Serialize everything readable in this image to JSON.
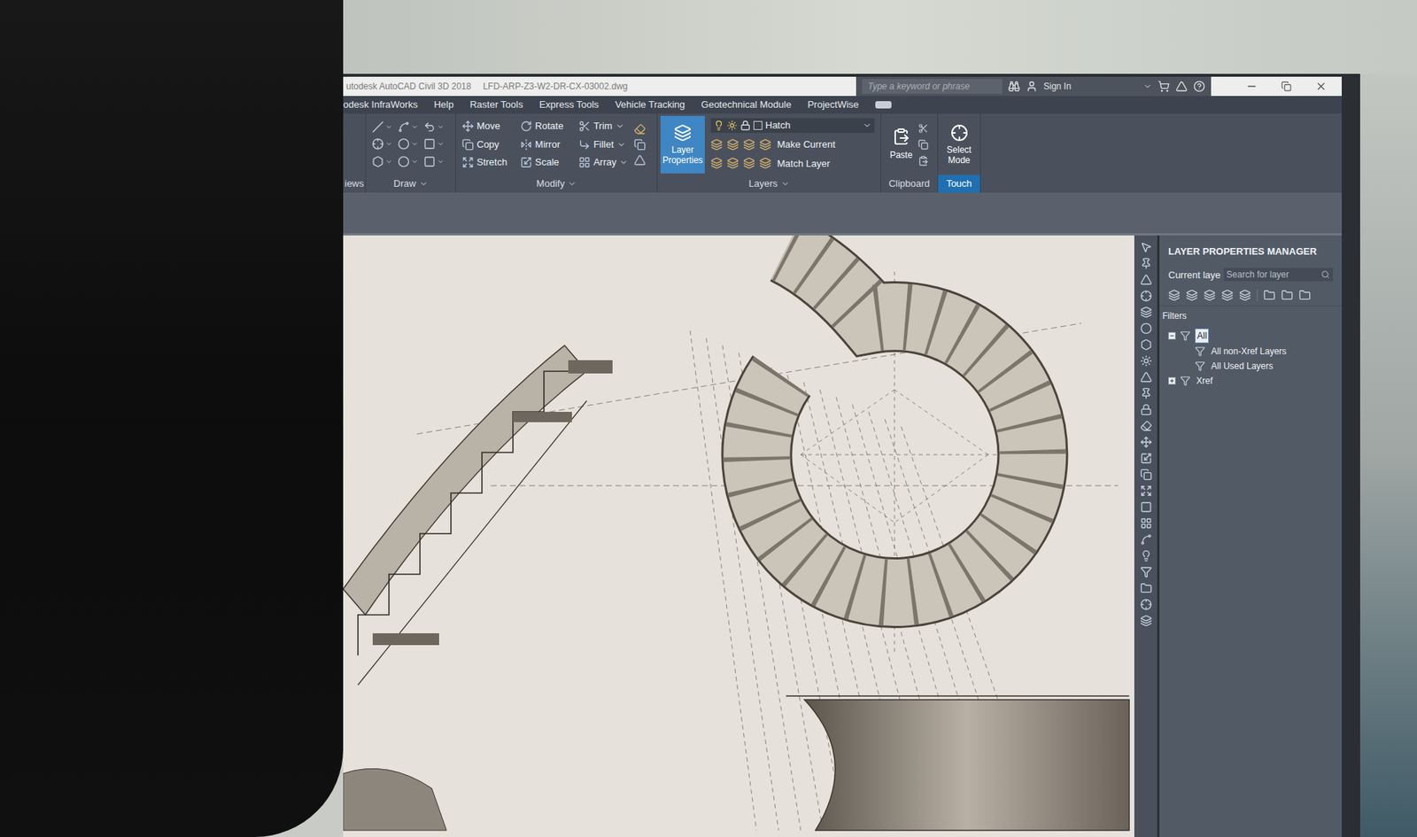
{
  "window": {
    "title": "utodesk AutoCAD Civil 3D 2018",
    "file": "LFD-ARP-Z3-W2-DR-CX-03002.dwg"
  },
  "search": {
    "placeholder": "Type a keyword or phrase"
  },
  "account": {
    "label": "Sign In"
  },
  "menu": [
    "odesk InfraWorks",
    "Help",
    "Raster Tools",
    "Express Tools",
    "Vehicle Tracking",
    "Geotechnical Module",
    "ProjectWise"
  ],
  "ribbon_groups": [
    {
      "label": "iews",
      "selected": false
    },
    {
      "label": "Draw",
      "selected": false
    },
    {
      "label": "Modify",
      "selected": false
    },
    {
      "label": "Layers",
      "selected": false
    },
    {
      "label": "Clipboard",
      "selected": false
    },
    {
      "label": "Touch",
      "selected": true
    }
  ],
  "modify_tools": [
    {
      "label": "Move",
      "dropdown": false
    },
    {
      "label": "Rotate",
      "dropdown": false
    },
    {
      "label": "Trim",
      "dropdown": true
    },
    {
      "label": "Copy",
      "dropdown": false
    },
    {
      "label": "Mirror",
      "dropdown": false
    },
    {
      "label": "Fillet",
      "dropdown": true
    },
    {
      "label": "Stretch",
      "dropdown": false
    },
    {
      "label": "Scale",
      "dropdown": false
    },
    {
      "label": "Array",
      "dropdown": true
    }
  ],
  "layers": {
    "button": "Layer Properties",
    "selected": true,
    "current": "Hatch",
    "actions": [
      "Make Current",
      "Match Layer"
    ]
  },
  "clipboard": {
    "button": "Paste"
  },
  "touch": {
    "button": "Select Mode"
  },
  "layer_panel": {
    "title": "LAYER PROPERTIES MANAGER",
    "current_label": "Current laye",
    "search_placeholder": "Search for layer",
    "filters_label": "Filters",
    "tree": [
      {
        "label": "All",
        "depth": 0,
        "selected": true,
        "expanded": true,
        "has_children": true
      },
      {
        "label": "All non-Xref Layers",
        "depth": 1,
        "selected": false,
        "expanded": false,
        "has_children": false
      },
      {
        "label": "All Used Layers",
        "depth": 1,
        "selected": false,
        "expanded": false,
        "has_children": false
      },
      {
        "label": "Xref",
        "depth": 0,
        "selected": false,
        "expanded": false,
        "has_children": true
      }
    ]
  }
}
